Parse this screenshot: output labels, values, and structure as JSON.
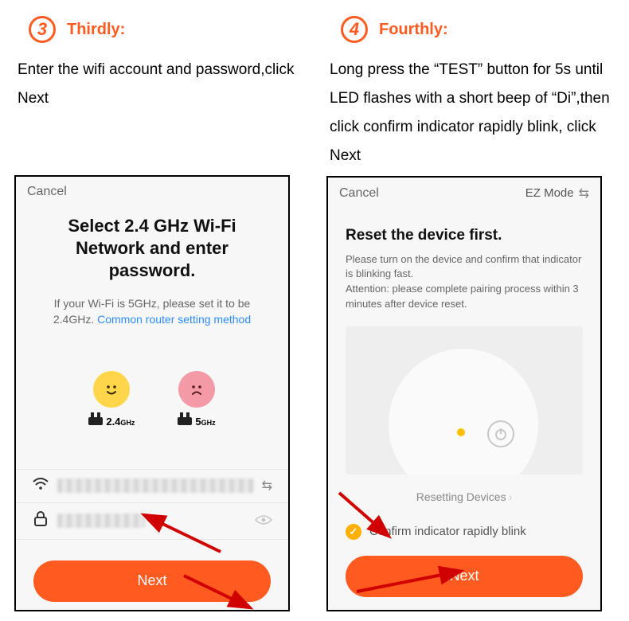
{
  "step3": {
    "num": "3",
    "title": "Thirdly:",
    "desc": "Enter the wifi account and password,click Next",
    "phone": {
      "cancel": "Cancel",
      "heading": "Select 2.4 GHz Wi-Fi Network and enter password.",
      "sub_pre": "If your Wi-Fi is 5GHz, please set it to be 2.4GHz. ",
      "sub_link": "Common router setting method",
      "band24": "2.4",
      "band24u": "GHz",
      "band5": "5",
      "band5u": "GHz",
      "next": "Next"
    }
  },
  "step4": {
    "num": "4",
    "title": "Fourthly:",
    "desc": "Long press the “TEST” button for 5s until LED flashes with a short beep of “Di”,then click confirm indicator rapidly blink, click Next",
    "phone": {
      "cancel": "Cancel",
      "mode": "EZ Mode",
      "heading": "Reset the device first.",
      "sub": "Please turn on the device and confirm that indicator is blinking fast.\nAttention: please complete pairing process within 3 minutes after device reset.",
      "resetting": "Resetting Devices",
      "confirm": "Confirm indicator rapidly blink",
      "next": "Next"
    }
  }
}
